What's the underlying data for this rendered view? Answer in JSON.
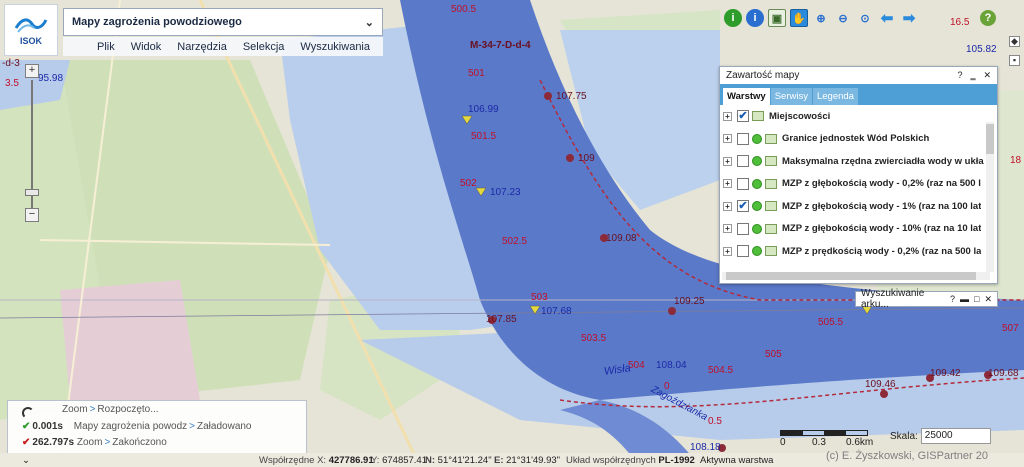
{
  "app": {
    "logo_text": "ISOK",
    "title": "Mapy zagrożenia powodziowego",
    "menu": [
      "Plik",
      "Widok",
      "Narzędzia",
      "Selekcja",
      "Wyszukiwania"
    ]
  },
  "toolbar": {
    "icons": [
      "info-green-icon",
      "info-blue-icon",
      "extent-icon",
      "pan-hand-icon",
      "zoom-in-icon",
      "zoom-out-icon",
      "zoom-full-icon",
      "back-arrow-icon",
      "forward-arrow-icon"
    ],
    "help": "?"
  },
  "zoom": {
    "plus": "+",
    "minus": "−"
  },
  "layer_panel": {
    "title": "Zawartość mapy",
    "help": "?",
    "close": "✕",
    "tabs": [
      "Warstwy",
      "Serwisy",
      "Legenda"
    ],
    "layers": [
      {
        "name": "Miejscowości",
        "checked": true
      },
      {
        "name": "Granice jednostek Wód Polskich",
        "checked": false
      },
      {
        "name": "Maksymalna rzędna zwierciadła wody w ukła",
        "checked": false
      },
      {
        "name": "MZP z głębokością wody - 0,2% (raz na 500 l",
        "checked": false
      },
      {
        "name": "MZP z głębokością wody - 1% (raz na 100 lat",
        "checked": true
      },
      {
        "name": "MZP z głębokością wody - 10% (raz na 10 lat",
        "checked": false
      },
      {
        "name": "MZP z prędkością wody - 0,2% (raz na 500 la",
        "checked": false
      }
    ]
  },
  "search_panel": {
    "title": "Wyszukiwanie arku...",
    "help": "?"
  },
  "status_log": {
    "line1": {
      "action": "Zoom",
      "state": "Rozpoczęto..."
    },
    "line2": {
      "time": "0.001s",
      "action": "Mapy zagrożenia powodz",
      "state": "Załadowano"
    },
    "line3": {
      "time": "262.797s",
      "action": "Zoom",
      "state": "Zakończono"
    }
  },
  "scale": {
    "ticks": [
      "0",
      "0.3",
      "0.6km"
    ],
    "label": "Skala:",
    "value": "25000"
  },
  "status_bar": {
    "x_label": "Współrzędne X:",
    "x_value": "427786.91",
    "y_label": "Y:",
    "y_value": "674857.41",
    "n_label": "N:",
    "n_value": "51°41'21.24\"",
    "e_label": "E:",
    "e_value": "21°31'49.93\"",
    "crs_label": "Układ współrzędnych",
    "crs_value": "PL-1992",
    "active_layer": "Aktywna warstwa",
    "copyright": "(c) E. Żyszkowski, GISPartner 20"
  },
  "map_labels": [
    {
      "text": "500.5"
    },
    {
      "text": "M-34-7-D-d-4"
    },
    {
      "text": "501"
    },
    {
      "text": "107.75"
    },
    {
      "text": "106.99"
    },
    {
      "text": "501.5"
    },
    {
      "text": "109"
    },
    {
      "text": "502"
    },
    {
      "text": "107.23"
    },
    {
      "text": "502.5"
    },
    {
      "text": "109.08"
    },
    {
      "text": "503"
    },
    {
      "text": "107.85"
    },
    {
      "text": "107.68"
    },
    {
      "text": "109.25"
    },
    {
      "text": "503.5"
    },
    {
      "text": "504"
    },
    {
      "text": "108.04"
    },
    {
      "text": "504.5"
    },
    {
      "text": "505"
    },
    {
      "text": "505.5"
    },
    {
      "text": "0"
    },
    {
      "text": "0.5"
    },
    {
      "text": "Wisła"
    },
    {
      "text": "Zagoździanka"
    },
    {
      "text": "109.46"
    },
    {
      "text": "109.42"
    },
    {
      "text": "109.68"
    },
    {
      "text": "108.18"
    },
    {
      "text": "16.5"
    },
    {
      "text": "105.82"
    },
    {
      "text": "507"
    },
    {
      "text": "18"
    },
    {
      "text": "95.98"
    },
    {
      "text": "3.5"
    },
    {
      "text": "-d-3"
    }
  ]
}
